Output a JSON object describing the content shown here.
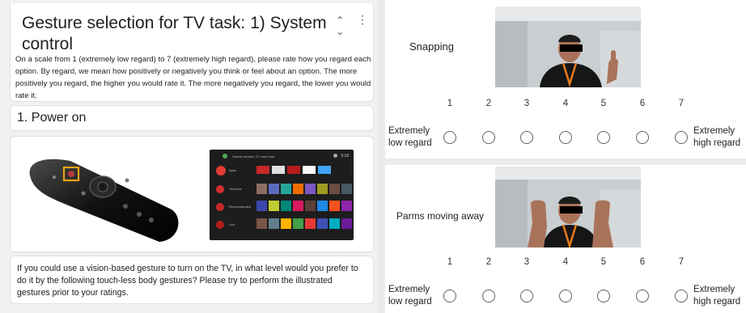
{
  "form": {
    "title": "Gesture selection for TV task: 1) System control",
    "description": "On a scale from 1 (extremely low regard) to 7 (extremely high regard), please rate how you regard each option. By regard, we mean how positively or negatively you think or feel about an option. The more positively you regard, the higher you would rate it. The more negatively you regard, the lower you would rate it.",
    "collapse_icon": "collapse-icon",
    "more_icon": "more-vert-icon"
  },
  "question": {
    "title": "1. Power on",
    "prompt": "If you could use a vision-based gesture to turn on the TV, in what level would you prefer to do it by the following touch-less body gestures? Please try to perform the illustrated gestures prior to your ratings."
  },
  "tv_screen": {
    "search_text": "Search movies, TV, and more",
    "time": "3:18",
    "row_labels": [
      "Apps",
      "YouTube",
      "Recommended",
      "Live"
    ]
  },
  "gestures": [
    {
      "label": "Snapping",
      "scale": [
        "1",
        "2",
        "3",
        "4",
        "5",
        "6",
        "7"
      ],
      "low_anchor": "Extremely low regard",
      "high_anchor": "Extremely high regard",
      "selected": null
    },
    {
      "label": "Parms moving away",
      "scale": [
        "1",
        "2",
        "3",
        "4",
        "5",
        "6",
        "7"
      ],
      "low_anchor": "Extremely low regard",
      "high_anchor": "Extremely high regard",
      "selected": null
    }
  ],
  "colors": {
    "highlight": "#e8a317",
    "lanyard": "#e87a1a",
    "tv_bg": "#1d1d1d",
    "accent": "#e53935"
  }
}
